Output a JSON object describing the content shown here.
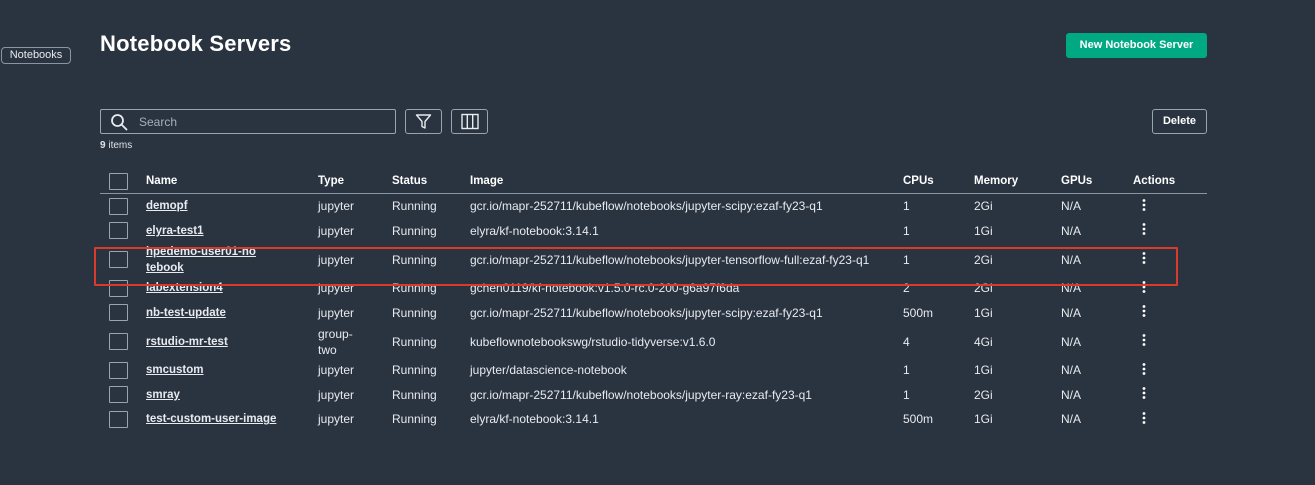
{
  "side_tab": "Notebooks",
  "page_title": "Notebook Servers",
  "new_button": "New Notebook Server",
  "search": {
    "placeholder": "Search",
    "value": ""
  },
  "delete_button": "Delete",
  "item_count": {
    "number": "9",
    "label": "items"
  },
  "columns": [
    "Name",
    "Type",
    "Status",
    "Image",
    "CPUs",
    "Memory",
    "GPUs",
    "Actions"
  ],
  "rows": [
    {
      "name": "demopf",
      "type": "jupyter",
      "status": "Running",
      "image": "gcr.io/mapr-252711/kubeflow/notebooks/jupyter-scipy:ezaf-fy23-q1",
      "cpus": "1",
      "memory": "2Gi",
      "gpus": "N/A"
    },
    {
      "name": "elyra-test1",
      "type": "jupyter",
      "status": "Running",
      "image": "elyra/kf-notebook:3.14.1",
      "cpus": "1",
      "memory": "1Gi",
      "gpus": "N/A"
    },
    {
      "name": "hpedemo-user01-notebook",
      "type": "jupyter",
      "status": "Running",
      "image": "gcr.io/mapr-252711/kubeflow/notebooks/jupyter-tensorflow-full:ezaf-fy23-q1",
      "cpus": "1",
      "memory": "2Gi",
      "gpus": "N/A",
      "highlighted": true
    },
    {
      "name": "labextension4",
      "type": "jupyter",
      "status": "Running",
      "image": "gchen0119/kf-notebook:v1.5.0-rc.0-200-g6a97f6da",
      "cpus": "2",
      "memory": "2Gi",
      "gpus": "N/A"
    },
    {
      "name": "nb-test-update",
      "type": "jupyter",
      "status": "Running",
      "image": "gcr.io/mapr-252711/kubeflow/notebooks/jupyter-scipy:ezaf-fy23-q1",
      "cpus": "500m",
      "memory": "1Gi",
      "gpus": "N/A"
    },
    {
      "name": "rstudio-mr-test",
      "type": "group-two",
      "status": "Running",
      "image": "kubeflownotebookswg/rstudio-tidyverse:v1.6.0",
      "cpus": "4",
      "memory": "4Gi",
      "gpus": "N/A"
    },
    {
      "name": "smcustom",
      "type": "jupyter",
      "status": "Running",
      "image": "jupyter/datascience-notebook",
      "cpus": "1",
      "memory": "1Gi",
      "gpus": "N/A"
    },
    {
      "name": "smray",
      "type": "jupyter",
      "status": "Running",
      "image": "gcr.io/mapr-252711/kubeflow/notebooks/jupyter-ray:ezaf-fy23-q1",
      "cpus": "1",
      "memory": "2Gi",
      "gpus": "N/A"
    },
    {
      "name": "test-custom-user-image",
      "type": "jupyter",
      "status": "Running",
      "image": "elyra/kf-notebook:3.14.1",
      "cpus": "500m",
      "memory": "1Gi",
      "gpus": "N/A"
    }
  ],
  "colors": {
    "background": "#2a3340",
    "accent": "#01a982",
    "highlight_border": "#d93a2b"
  },
  "icons": [
    "search-icon",
    "filter-icon",
    "columns-icon",
    "more-vertical-icon"
  ]
}
